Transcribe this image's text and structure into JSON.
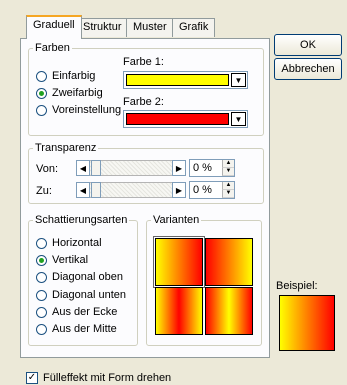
{
  "tabs": [
    {
      "label": "Graduell",
      "active": true
    },
    {
      "label": "Struktur",
      "active": false
    },
    {
      "label": "Muster",
      "active": false
    },
    {
      "label": "Grafik",
      "active": false
    }
  ],
  "farben": {
    "legend": "Farben",
    "options": [
      {
        "label": "Einfarbig",
        "selected": false
      },
      {
        "label": "Zweifarbig",
        "selected": true
      },
      {
        "label": "Voreinstellung",
        "selected": false
      }
    ],
    "farbe1_label": "Farbe 1:",
    "farbe1_color": "#ffff00",
    "farbe2_label": "Farbe 2:",
    "farbe2_color": "#ff0000"
  },
  "transparenz": {
    "legend": "Transparenz",
    "von_label": "Von:",
    "von_value": "0 %",
    "zu_label": "Zu:",
    "zu_value": "0 %"
  },
  "schattierung": {
    "legend": "Schattierungsarten",
    "options": [
      {
        "label": "Horizontal",
        "selected": false
      },
      {
        "label": "Vertikal",
        "selected": true
      },
      {
        "label": "Diagonal oben",
        "selected": false
      },
      {
        "label": "Diagonal unten",
        "selected": false
      },
      {
        "label": "Aus der Ecke",
        "selected": false
      },
      {
        "label": "Aus der Mitte",
        "selected": false
      }
    ]
  },
  "varianten": {
    "legend": "Varianten"
  },
  "buttons": {
    "ok": "OK",
    "cancel": "Abbrechen"
  },
  "beispiel_label": "Beispiel:",
  "checkbox": {
    "label": "Fülleffekt mit Form drehen",
    "checked": true
  }
}
